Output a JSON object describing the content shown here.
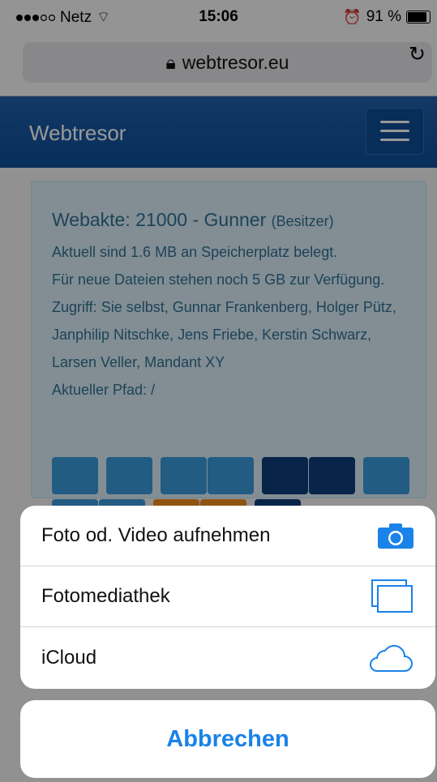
{
  "status_bar": {
    "carrier": "Netz",
    "time": "15:06",
    "battery": "91 %"
  },
  "browser": {
    "url": "webtresor.eu"
  },
  "navbar": {
    "brand": "Webtresor"
  },
  "panel": {
    "title": "Webakte: 21000 - Gunner",
    "title_suffix": "(Besitzer)",
    "lines": [
      "Aktuell sind 1.6 MB an Speicherplatz belegt.",
      "Für neue Dateien stehen noch 5 GB zur Verfügung.",
      "Zugriff: Sie selbst, Gunnar Frankenberg, Holger Pütz, Janphilip Nitschke, Jens Friebe, Kerstin Schwarz, Larsen Veller, Mandant XY",
      "Aktueller Pfad: /"
    ]
  },
  "action_sheet": {
    "items": [
      {
        "label": "Foto od. Video aufnehmen",
        "icon": "camera-icon"
      },
      {
        "label": "Fotomediathek",
        "icon": "photo-library-icon"
      },
      {
        "label": "iCloud",
        "icon": "icloud-icon"
      }
    ],
    "cancel_label": "Abbrechen"
  },
  "colors": {
    "nav_blue": "#1a5aa2",
    "panel_bg": "#d9edf7",
    "panel_text": "#31708f",
    "ios_blue": "#1a82e8"
  }
}
